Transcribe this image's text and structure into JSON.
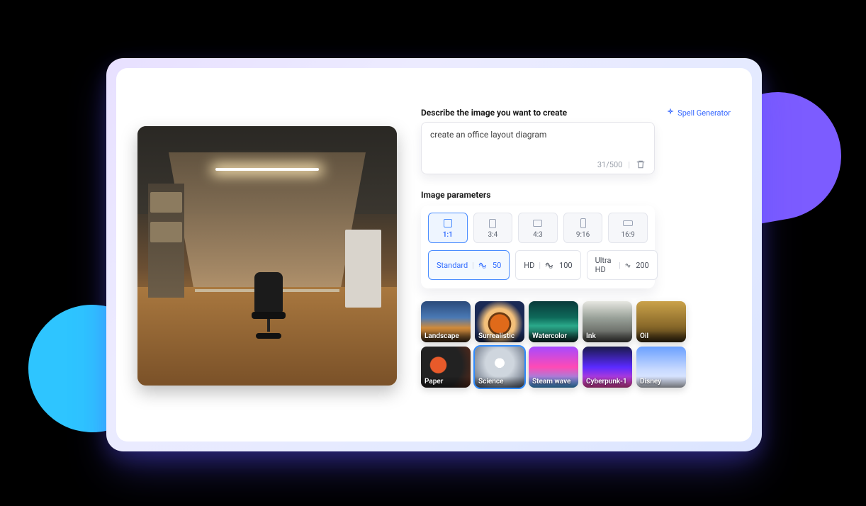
{
  "prompt": {
    "label": "Describe the image you want to create",
    "spell_link": "Spell Generator",
    "value": "create an office layout diagram",
    "counter": "31/500"
  },
  "parameters": {
    "label": "Image parameters",
    "ratios": [
      {
        "label": "1:1",
        "w": 12,
        "h": 12,
        "selected": true
      },
      {
        "label": "3:4",
        "w": 10,
        "h": 13,
        "selected": false
      },
      {
        "label": "4:3",
        "w": 13,
        "h": 10,
        "selected": false
      },
      {
        "label": "9:16",
        "w": 8,
        "h": 14,
        "selected": false
      },
      {
        "label": "16:9",
        "w": 14,
        "h": 8,
        "selected": false
      }
    ],
    "quality": [
      {
        "name": "Standard",
        "credits": "50",
        "selected": true
      },
      {
        "name": "HD",
        "credits": "100",
        "selected": false
      },
      {
        "name": "Ultra HD",
        "credits": "200",
        "selected": false
      }
    ]
  },
  "styles": [
    [
      {
        "label": "Landscape",
        "cls": "g-landscape",
        "selected": false
      },
      {
        "label": "Surrealistic",
        "cls": "g-surreal",
        "selected": false
      },
      {
        "label": "Watercolor",
        "cls": "g-water",
        "selected": false
      },
      {
        "label": "Ink",
        "cls": "g-ink",
        "selected": false
      },
      {
        "label": "Oil",
        "cls": "g-oil",
        "selected": false
      }
    ],
    [
      {
        "label": "Paper",
        "cls": "g-paper",
        "selected": false
      },
      {
        "label": "Science",
        "cls": "g-science",
        "selected": true
      },
      {
        "label": "Steam wave",
        "cls": "g-steam",
        "selected": false
      },
      {
        "label": "Cyberpunk-1",
        "cls": "g-cyber",
        "selected": false
      },
      {
        "label": "Disney",
        "cls": "g-disney",
        "selected": false
      }
    ]
  ]
}
